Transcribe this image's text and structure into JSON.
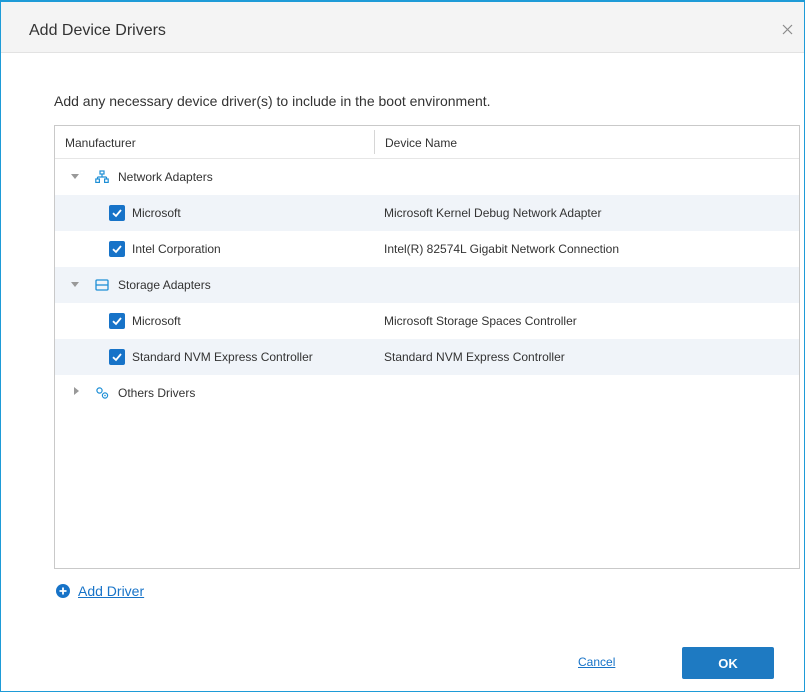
{
  "dialog": {
    "title": "Add Device Drivers",
    "description": "Add any necessary device driver(s) to include in the boot environment."
  },
  "grid": {
    "columns": [
      "Manufacturer",
      "Device Name"
    ],
    "groups": [
      {
        "label": "Network Adapters",
        "icon": "network-icon",
        "expanded": true,
        "rows": [
          {
            "manufacturer": "Microsoft",
            "device": "Microsoft Kernel Debug Network Adapter",
            "checked": true
          },
          {
            "manufacturer": "Intel Corporation",
            "device": "Intel(R) 82574L Gigabit Network Connection",
            "checked": true
          }
        ]
      },
      {
        "label": "Storage Adapters",
        "icon": "storage-icon",
        "expanded": true,
        "rows": [
          {
            "manufacturer": "Microsoft",
            "device": "Microsoft Storage Spaces Controller",
            "checked": true
          },
          {
            "manufacturer": "Standard NVM Express Controller",
            "device": "Standard NVM Express Controller",
            "checked": true
          }
        ]
      },
      {
        "label": "Others Drivers",
        "icon": "gears-icon",
        "expanded": false,
        "rows": []
      }
    ]
  },
  "actions": {
    "add_driver": "Add Driver",
    "cancel": "Cancel",
    "ok": "OK"
  },
  "colors": {
    "accent": "#1773c8",
    "dialog_border": "#1e9bd7",
    "row_highlight": "#f0f4f9"
  }
}
